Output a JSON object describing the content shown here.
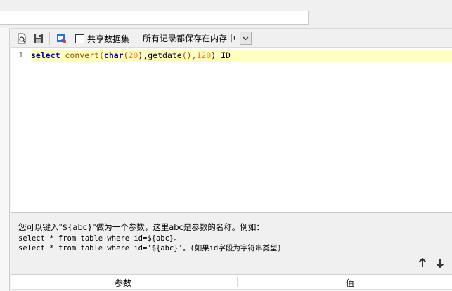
{
  "toolbar": {
    "share_label": "共享数据集",
    "record_mode": "所有记录都保存在内存中"
  },
  "editor": {
    "line_numbers": [
      "1"
    ],
    "code_tokens": {
      "kw_select": "select",
      "fn_convert": "convert",
      "p1": "(",
      "kw_char": "char",
      "p2": "(",
      "num_20": "20",
      "p3": "),",
      "fn_getdate": "getdate",
      "p4": "(),",
      "num_120": "120",
      "p5": ") ID"
    }
  },
  "help": {
    "line1": "您可以键入\"${abc}\"做为一个参数，这里abc是参数的名称。例如：",
    "line2": "select * from table where id=${abc}。",
    "line3": "select * from table where id='${abc}'。(如果id字段为字符串类型)"
  },
  "params": {
    "col_param": "参数",
    "col_value": "值"
  },
  "icons": {
    "preview": "search-doc-icon",
    "save": "floppy-icon",
    "export": "export-icon",
    "up": "arrow-up-icon",
    "down": "arrow-down-icon"
  }
}
